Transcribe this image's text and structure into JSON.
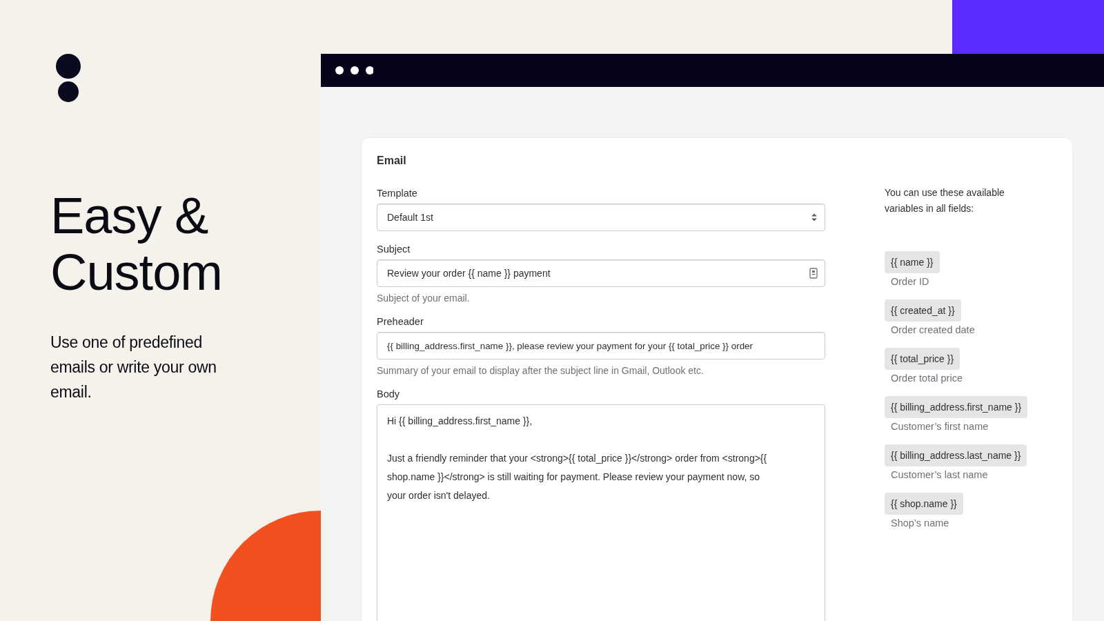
{
  "promo": {
    "heading": "Easy & Custom",
    "text": "Use one of predefined emails or write your own email."
  },
  "card": {
    "title": "Email",
    "fields": [
      {
        "kind": "select",
        "label": "Template",
        "value": "Default 1st"
      },
      {
        "kind": "input_picker",
        "label": "Subject",
        "value": "Review your order {{ name }} payment",
        "help": "Subject of your email."
      },
      {
        "kind": "input",
        "label": "Preheader",
        "value": "{{ billing_address.first_name }}, please review your payment for your {{ total_price }} order",
        "help": "Summary of your email to display after the subject line in Gmail, Outlook etc."
      },
      {
        "kind": "textarea",
        "label": "Body",
        "paragraphs": [
          "Hi {{ billing_address.first_name }},",
          "Just a friendly reminder that your <strong>{{ total_price }}</strong> order from <strong>{{ shop.name }}</strong> is still waiting for payment. Please review your payment now, so your order isn't delayed."
        ]
      }
    ],
    "variables_intro": "You can use these available variables in all fields:",
    "variables": [
      {
        "code": "{{ name }}",
        "description": "Order ID"
      },
      {
        "code": "{{ created_at }}",
        "description": "Order created date"
      },
      {
        "code": "{{ total_price }}",
        "description": "Order total price"
      },
      {
        "code": "{{ billing_address.first_name }}",
        "description": "Customer’s first name"
      },
      {
        "code": "{{ billing_address.last_name }}",
        "description": "Customer’s last name"
      },
      {
        "code": "{{ shop.name }}",
        "description": "Shop’s name"
      }
    ]
  }
}
